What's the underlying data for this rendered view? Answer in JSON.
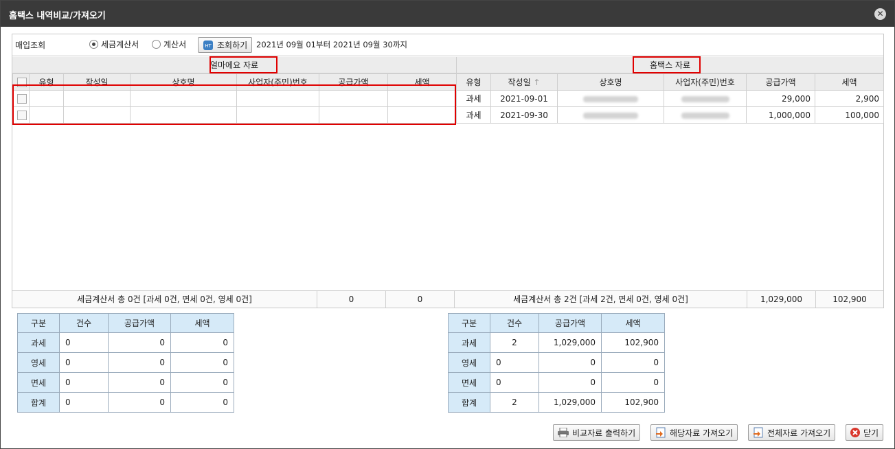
{
  "window": {
    "title": "홈택스 내역비교/가져오기"
  },
  "query": {
    "label": "매입조회",
    "radio_tax": "세금계산서",
    "radio_bill": "계산서",
    "search_button": "조회하기",
    "period": "2021년 09월 01부터 2021년 09월 30까지"
  },
  "left": {
    "title": "얼마에요 자료",
    "headers": [
      "유형",
      "작성일",
      "상호명",
      "사업자(주민)번호",
      "공급가액",
      "세액"
    ],
    "summary": "세금계산서 총 0건 [과세 0건, 면세 0건, 영세 0건]",
    "summary_supply": "0",
    "summary_tax": "0"
  },
  "right": {
    "title": "홈택스 자료",
    "headers": [
      "유형",
      "작성일",
      "상호명",
      "사업자(주민)번호",
      "공급가액",
      "세액"
    ],
    "rows": [
      {
        "type": "과세",
        "date": "2021-09-01",
        "supply": "29,000",
        "tax": "2,900"
      },
      {
        "type": "과세",
        "date": "2021-09-30",
        "supply": "1,000,000",
        "tax": "100,000"
      }
    ],
    "summary": "세금계산서 총 2건 [과세 2건, 면세 0건, 영세 0건]",
    "summary_supply": "1,029,000",
    "summary_tax": "102,900"
  },
  "stat_headers": [
    "구분",
    "건수",
    "공급가액",
    "세액"
  ],
  "left_stats": [
    {
      "cat": "과세",
      "count": "0",
      "supply": "0",
      "tax": "0"
    },
    {
      "cat": "영세",
      "count": "0",
      "supply": "0",
      "tax": "0"
    },
    {
      "cat": "면세",
      "count": "0",
      "supply": "0",
      "tax": "0"
    },
    {
      "cat": "합계",
      "count": "0",
      "supply": "0",
      "tax": "0"
    }
  ],
  "right_stats": [
    {
      "cat": "과세",
      "count": "2",
      "supply": "1,029,000",
      "tax": "102,900"
    },
    {
      "cat": "영세",
      "count": "0",
      "supply": "0",
      "tax": "0"
    },
    {
      "cat": "면세",
      "count": "0",
      "supply": "0",
      "tax": "0"
    },
    {
      "cat": "합계",
      "count": "2",
      "supply": "1,029,000",
      "tax": "102,900"
    }
  ],
  "buttons": {
    "print": "비교자료 출력하기",
    "import_selected": "해당자료 가져오기",
    "import_all": "전체자료 가져오기",
    "close": "닫기"
  },
  "colors": {
    "titlebar": "#3a3a3a",
    "highlight": "#e00000",
    "stat_header": "#d6eaf8"
  }
}
